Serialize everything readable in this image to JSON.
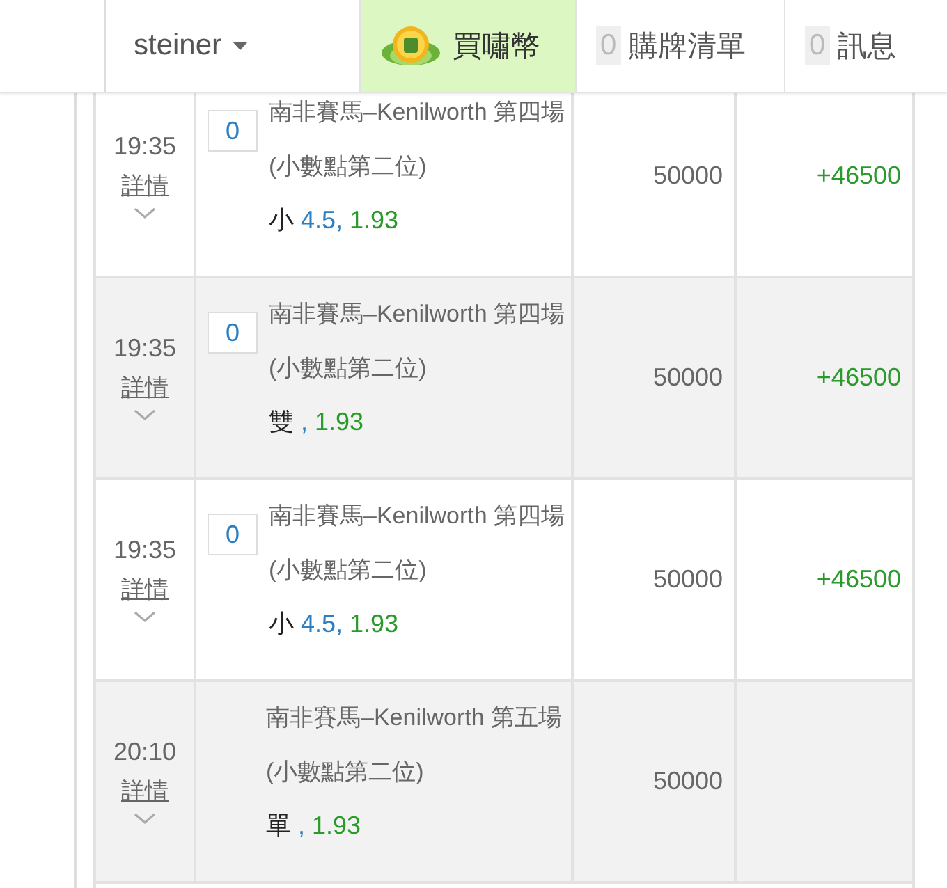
{
  "header": {
    "user": "steiner",
    "buy_coins": "買嘯幣",
    "cart": {
      "count": "0",
      "label": "購牌清單"
    },
    "messages": {
      "count": "0",
      "label": "訊息"
    }
  },
  "rows": [
    {
      "time": "19:35",
      "details": "詳情",
      "odds_box": "0",
      "event": "南非賽馬–Kenilworth 第四場 (小數點第二位)",
      "selection": "小",
      "line": " 4.5,",
      "odds": " 1.93",
      "amount": "50000",
      "profit": "+46500",
      "shaded": false
    },
    {
      "time": "19:35",
      "details": "詳情",
      "odds_box": "0",
      "event": "南非賽馬–Kenilworth 第四場 (小數點第二位)",
      "selection": "雙",
      "line": " ,",
      "odds": " 1.93",
      "amount": "50000",
      "profit": "+46500",
      "shaded": true
    },
    {
      "time": "19:35",
      "details": "詳情",
      "odds_box": "0",
      "event": "南非賽馬–Kenilworth 第四場 (小數點第二位)",
      "selection": "小",
      "line": " 4.5,",
      "odds": " 1.93",
      "amount": "50000",
      "profit": "+46500",
      "shaded": false
    },
    {
      "time": "20:10",
      "details": "詳情",
      "event": "南非賽馬–Kenilworth 第五場 (小數點第二位)",
      "selection": "單",
      "line": " ,",
      "odds": " 1.93",
      "amount": "50000",
      "shaded": true
    }
  ]
}
